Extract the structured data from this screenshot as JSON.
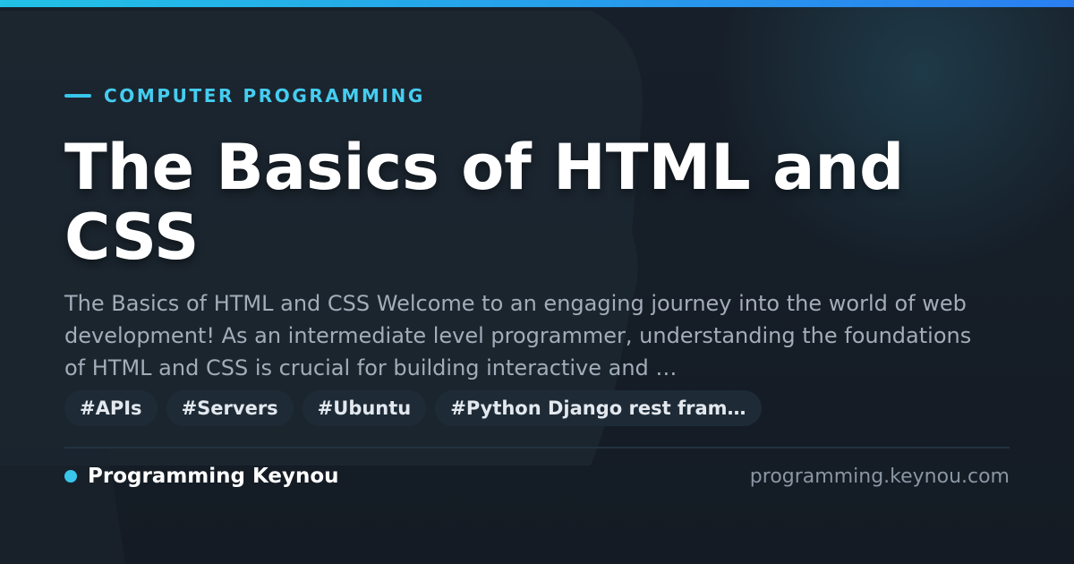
{
  "theme": {
    "accent": "#38c6ec",
    "accent_secondary": "#2a7ff0",
    "background": "#141b24",
    "title_color": "#ffffff",
    "text_color": "#a3adb9"
  },
  "header": {
    "category": "COMPUTER PROGRAMMING"
  },
  "article": {
    "title": "The Basics of HTML and CSS",
    "excerpt": "The Basics of HTML and CSS Welcome to an engaging journey into the world of web development! As an intermediate level programmer, understanding the foundations of HTML and CSS is crucial for building interactive and …"
  },
  "tags": [
    "#APIs",
    "#Servers",
    "#Ubuntu",
    "#Python Django rest fram…"
  ],
  "footer": {
    "brand": "Programming Keynou",
    "url": "programming.keynou.com"
  }
}
